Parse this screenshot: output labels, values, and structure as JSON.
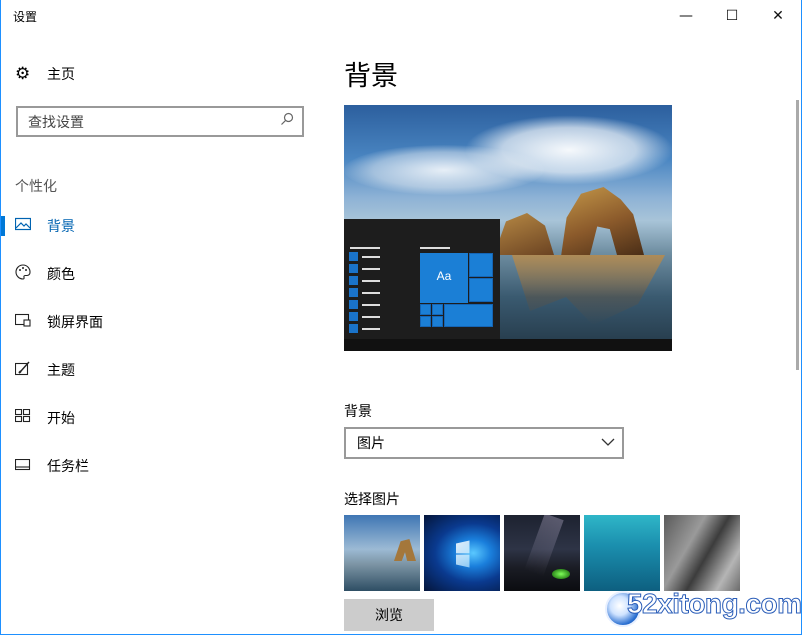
{
  "window": {
    "title": "设置",
    "minimize_glyph": "—",
    "maximize_glyph": "☐",
    "close_glyph": "✕"
  },
  "sidebar": {
    "home_label": "主页",
    "home_icon": "gear-icon",
    "search_placeholder": "查找设置",
    "search_icon": "search-icon",
    "section_label": "个性化",
    "items": [
      {
        "label": "背景",
        "icon": "picture-icon",
        "active": true
      },
      {
        "label": "颜色",
        "icon": "palette-icon",
        "active": false
      },
      {
        "label": "锁屏界面",
        "icon": "lock-screen-icon",
        "active": false
      },
      {
        "label": "主题",
        "icon": "theme-icon",
        "active": false
      },
      {
        "label": "开始",
        "icon": "start-icon",
        "active": false
      },
      {
        "label": "任务栏",
        "icon": "taskbar-icon",
        "active": false
      }
    ]
  },
  "main": {
    "page_title": "背景",
    "preview_tile_text": "Aa",
    "background_label": "背景",
    "background_select_value": "图片",
    "choose_picture_label": "选择图片",
    "browse_label": "浏览"
  },
  "watermark": {
    "text": "52xitong.com"
  },
  "colors": {
    "accent": "#0078d7",
    "active_text": "#0063b1",
    "button_bg": "#cccccc"
  }
}
